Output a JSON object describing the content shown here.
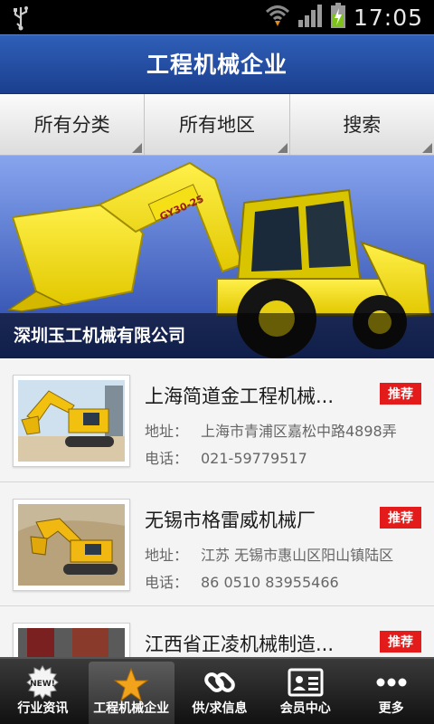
{
  "status": {
    "time": "17:05"
  },
  "title": "工程机械企业",
  "filters": [
    {
      "label": "所有分类"
    },
    {
      "label": "所有地区"
    },
    {
      "label": "搜索"
    }
  ],
  "banner": {
    "caption": "深圳玉工机械有限公司",
    "machine_plate": "GY30-25",
    "slides": 6,
    "active_slide": 2
  },
  "list": {
    "address_label": "地址：",
    "phone_label": "电话：",
    "items": [
      {
        "name": "上海简道金工程机械...",
        "badge": "推荐",
        "address": "上海市青浦区嘉松中路4898弄",
        "phone": "021-59779517"
      },
      {
        "name": "无锡市格雷威机械厂",
        "badge": "推荐",
        "address": "江苏 无锡市惠山区阳山镇陆区",
        "phone": "86 0510 83955466"
      },
      {
        "name": "江西省正凌机械制造...",
        "badge": "推荐",
        "address": "",
        "phone": ""
      }
    ]
  },
  "nav": [
    {
      "label": "行业资讯",
      "icon": "new-badge-icon",
      "badge_text": "NEW!"
    },
    {
      "label": "工程机械企业",
      "icon": "star-icon",
      "active": true
    },
    {
      "label": "供/求信息",
      "icon": "link-icon"
    },
    {
      "label": "会员中心",
      "icon": "member-card-icon"
    },
    {
      "label": "更多",
      "icon": "more-dots-icon"
    }
  ],
  "colors": {
    "titlebar": "#2f5fb8",
    "badge": "#e41b1b",
    "accent_star": "#f2a31c"
  }
}
